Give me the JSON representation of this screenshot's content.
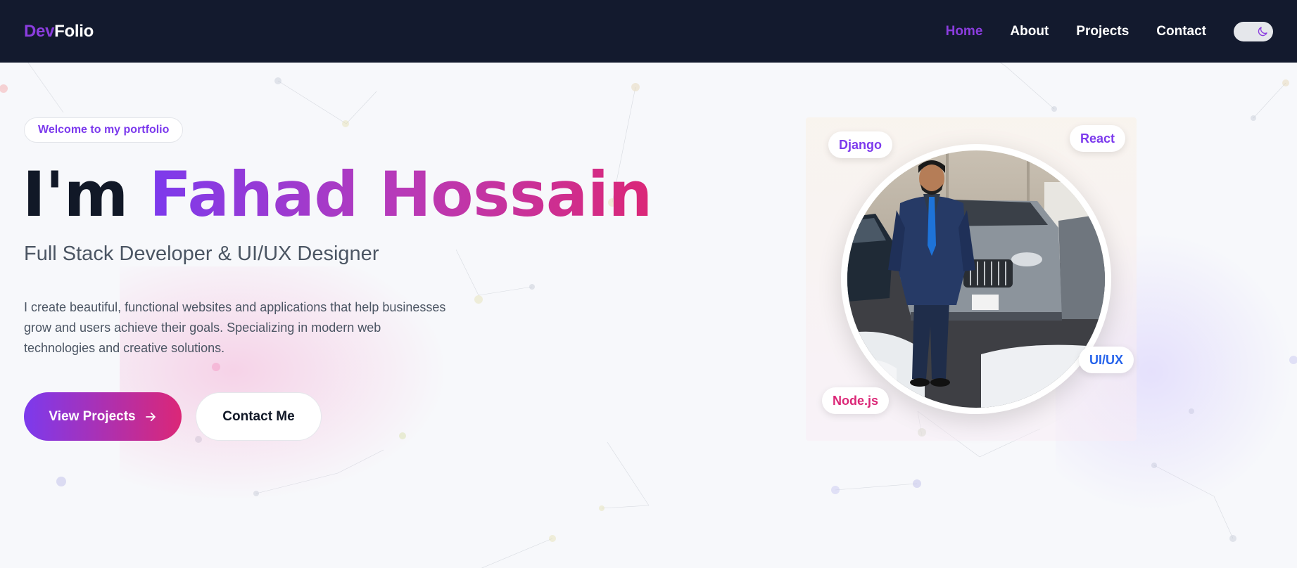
{
  "nav": {
    "logo_part1": "Dev",
    "logo_part2": "Folio",
    "links": [
      "Home",
      "About",
      "Projects",
      "Contact"
    ],
    "active_link": "Home",
    "theme_toggle_icon": "moon-icon"
  },
  "hero": {
    "badge": "Welcome to my portfolio",
    "title_prefix": "I'm",
    "title_name": "Fahad Hossain",
    "subtitle": "Full Stack Developer & UI/UX Designer",
    "description": "I create beautiful, functional websites and applications that help businesses grow and users achieve their goals. Specializing in modern web technologies and creative solutions.",
    "primary_button": "View Projects",
    "primary_button_icon": "arrow-right-icon",
    "secondary_button": "Contact Me"
  },
  "profile": {
    "skill_tags": [
      {
        "label": "Django",
        "color": "#7c3aed"
      },
      {
        "label": "React",
        "color": "#7c3aed"
      },
      {
        "label": "UI/UX",
        "color": "#2563eb"
      },
      {
        "label": "Node.js",
        "color": "#db2777"
      }
    ]
  },
  "colors": {
    "nav_bg": "#131a2e",
    "accent_purple": "#7c3aed",
    "accent_pink": "#db2777",
    "page_bg": "#f7f8fb"
  }
}
